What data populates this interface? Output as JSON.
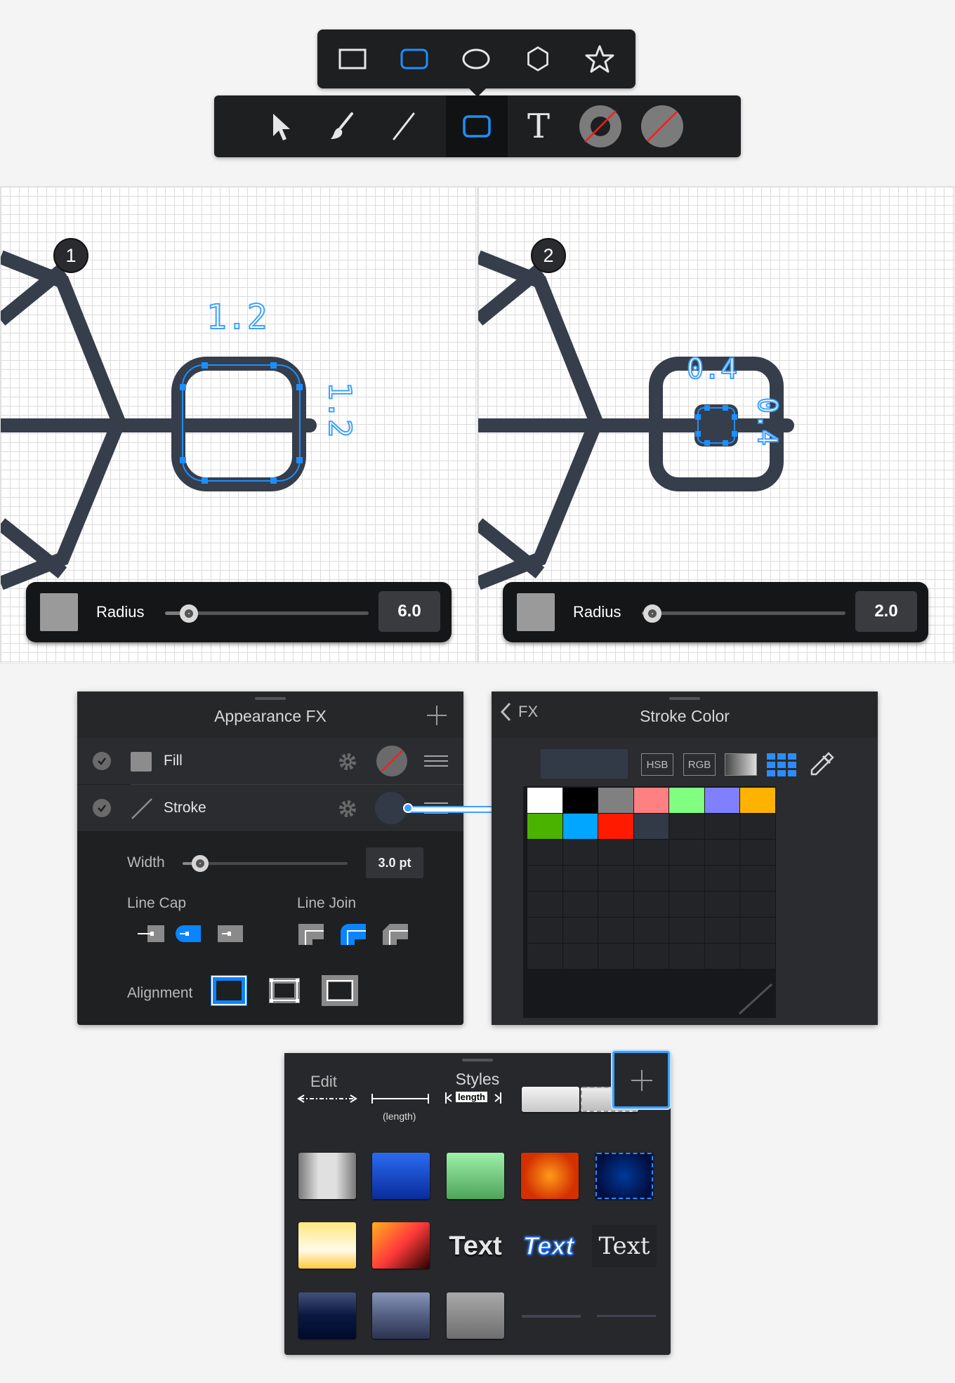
{
  "toolbar_shapes": {
    "items": [
      {
        "icon": "rectangle-icon"
      },
      {
        "icon": "rounded-rectangle-icon",
        "selected": true
      },
      {
        "icon": "ellipse-icon"
      },
      {
        "icon": "hexagon-icon"
      },
      {
        "icon": "star-icon"
      }
    ]
  },
  "toolbar_main": {
    "items": [
      {
        "icon": "select-arrow-icon"
      },
      {
        "icon": "brush-icon"
      },
      {
        "icon": "line-icon"
      },
      {
        "icon": "rounded-rectangle-icon",
        "selected": true
      },
      {
        "icon": "text-icon",
        "label": "T"
      },
      {
        "icon": "stroke-color-icon"
      },
      {
        "icon": "fill-color-icon"
      }
    ]
  },
  "canvas1": {
    "step": "1",
    "dim_top": "1.2",
    "dim_side": "1.2",
    "radius_label": "Radius",
    "radius_value": "6.0",
    "slider_fraction": 0.12
  },
  "canvas2": {
    "step": "2",
    "dim_top": "0.4",
    "dim_side": "0.4",
    "radius_label": "Radius",
    "radius_value": "2.0",
    "slider_fraction": 0.12
  },
  "appearance": {
    "title": "Appearance FX",
    "fill_label": "Fill",
    "stroke_label": "Stroke",
    "width_label": "Width",
    "width_value": "3.0 pt",
    "line_cap_label": "Line Cap",
    "line_join_label": "Line Join",
    "alignment_label": "Alignment",
    "stroke_color": "#323a48"
  },
  "stroke_color_panel": {
    "back_label": "FX",
    "title": "Stroke Color",
    "hsb_label": "HSB",
    "rgb_label": "RGB",
    "current_color": "#323a48",
    "swatches_row1": [
      "#ffffff",
      "#000000",
      "#808080",
      "#ff8080",
      "#80ff80",
      "#8080ff",
      "#ffb300"
    ],
    "swatches_row2": [
      "#4ab300",
      "#00a6ff",
      "#ff1a00",
      "#323a48"
    ]
  },
  "styles": {
    "edit_label": "Edit",
    "title": "Styles",
    "length_label": "length",
    "length_caption": "(length)",
    "text_labels": [
      "Text",
      "Text",
      "Text"
    ]
  }
}
